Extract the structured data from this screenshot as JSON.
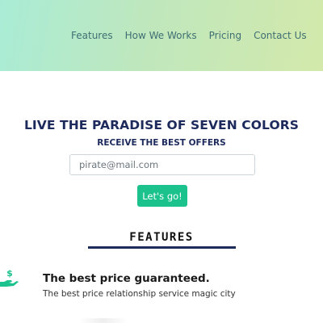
{
  "nav": {
    "items": [
      {
        "label": "Features"
      },
      {
        "label": "How We Works"
      },
      {
        "label": "Pricing"
      },
      {
        "label": "Contact Us"
      }
    ]
  },
  "hero": {
    "title": "LIVE THE PARADISE OF SEVEN COLORS",
    "subtitle": "RECEIVE THE BEST OFFERS",
    "email_placeholder": "pirate@mail.com",
    "email_value": "",
    "submit_label": "Let's go!"
  },
  "features": {
    "heading": "FEATURES",
    "items": [
      {
        "icon": "hand-money-icon",
        "title": "The best price guaranteed.",
        "description": "The best price relationship service magic city"
      }
    ]
  },
  "colors": {
    "accent": "#1bc28c",
    "heading": "#1d2a5c",
    "nav_text": "#3f6f74"
  }
}
